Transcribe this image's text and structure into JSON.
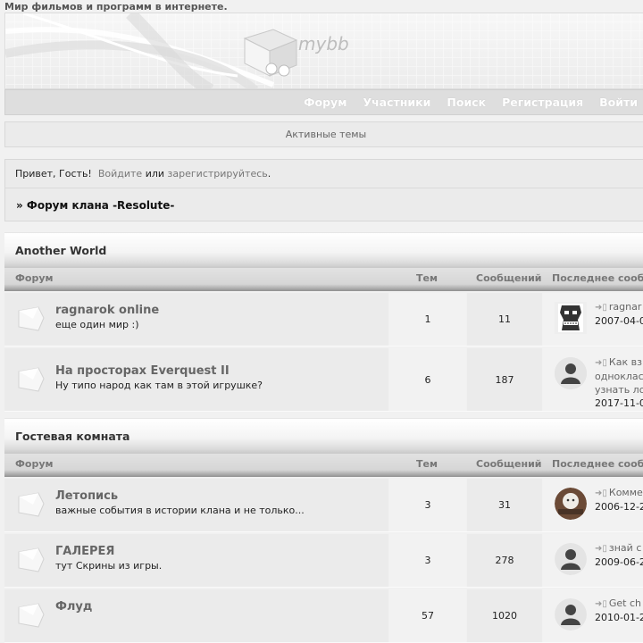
{
  "site": {
    "description": "Мир фильмов и программ в интернете.",
    "logo_text": "mybb"
  },
  "nav": {
    "items": [
      "Форум",
      "Участники",
      "Поиск",
      "Регистрация",
      "Войти"
    ]
  },
  "active_topics": "Активные темы",
  "welcome": {
    "greeting": "Привет, Гость!",
    "login_link": "Войдите",
    "or": "или",
    "register_link": "зарегистрируйтесь",
    "period": ".",
    "breadcrumb": "» Форум клана -Resolute-"
  },
  "columns": {
    "forum": "Форум",
    "topics": "Тем",
    "posts": "Сообщений",
    "last_post": "Последнее сооб"
  },
  "categories": [
    {
      "title": "Another World",
      "forums": [
        {
          "title": "ragnarok online",
          "desc": "еще один мир :)",
          "topics": "1",
          "posts": "11",
          "last_lines": [
            "ragnar",
            "2007-04-0"
          ],
          "avatar": "mask-avatar"
        },
        {
          "title": "На просторах Everquest II",
          "desc": "Ну типо народ как там в этой игрушке?",
          "topics": "6",
          "posts": "187",
          "last_lines": [
            "Как вз",
            "однокласс",
            "узнать ло",
            "2017-11-0"
          ],
          "avatar": "default-avatar"
        }
      ]
    },
    {
      "title": "Гостевая комната",
      "forums": [
        {
          "title": "Летопись",
          "desc": "важные события в истории клана и не только...",
          "topics": "3",
          "posts": "31",
          "last_lines": [
            "Комме",
            "2006-12-2"
          ],
          "avatar": "photo-avatar"
        },
        {
          "title": "ГАЛЕРЕЯ",
          "desc": "тут Скрины из игры.",
          "topics": "3",
          "posts": "278",
          "last_lines": [
            "знай с",
            "2009-06-2"
          ],
          "avatar": "default-avatar"
        },
        {
          "title": "Флуд",
          "desc": "",
          "topics": "57",
          "posts": "1020",
          "last_lines": [
            "Get ch",
            "2010-01-2"
          ],
          "avatar": "default-avatar"
        }
      ]
    }
  ]
}
